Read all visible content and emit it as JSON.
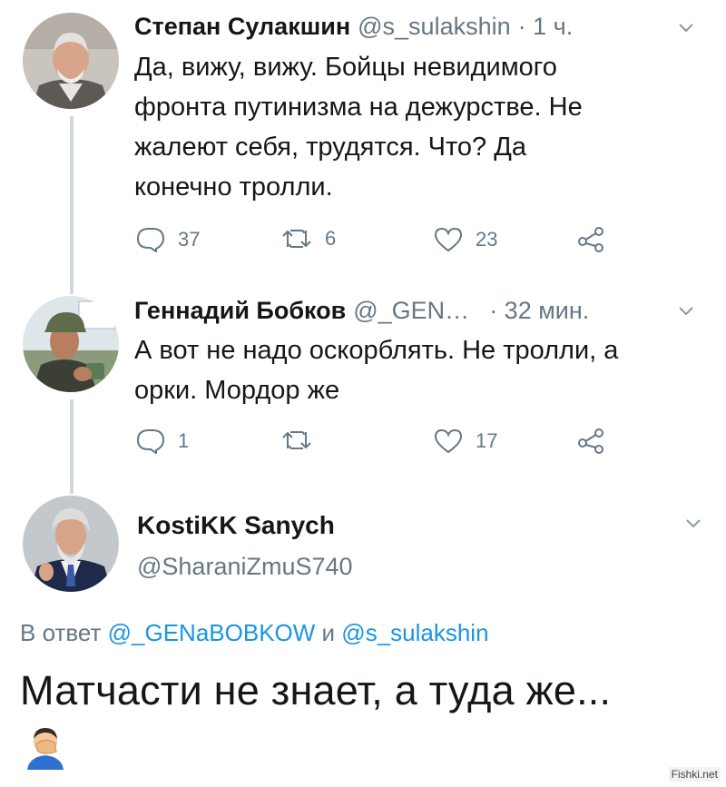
{
  "tweets": [
    {
      "name": "Степан Сулакшин",
      "handle": "@s_sulakshin",
      "time": "· 1 ч.",
      "text_lines": [
        "Да, вижу, вижу. Бойцы невидимого",
        "фронта путинизма на дежурстве. Не",
        "жалеют себя, трудятся. Что? Да",
        "конечно тролли."
      ],
      "replies": "37",
      "retweets": "6",
      "likes": "23"
    },
    {
      "name": "Геннадий Бобков",
      "handle": "@_GEN…",
      "time": "· 32 мин.",
      "text_lines": [
        "А вот не надо оскорблять. Не тролли, а",
        "орки. Мордор же"
      ],
      "replies": "1",
      "retweets": "",
      "likes": "17"
    }
  ],
  "focused_tweet": {
    "name": "KostiKK Sanych",
    "handle": "@SharaniZmuS740",
    "reply_prefix": "В ответ",
    "reply_mention_1": "@_GENaBOBKOW",
    "reply_joiner": "и",
    "reply_mention_2": "@s_sulakshin",
    "text": "Матчасти не знает, а туда же...",
    "emoji": "facepalm-emoji"
  },
  "watermark": "Fishki.net",
  "colors": {
    "text": "#14171a",
    "secondary": "#657786",
    "link": "#1b95e0",
    "thread_line": "#cfd8dd"
  }
}
